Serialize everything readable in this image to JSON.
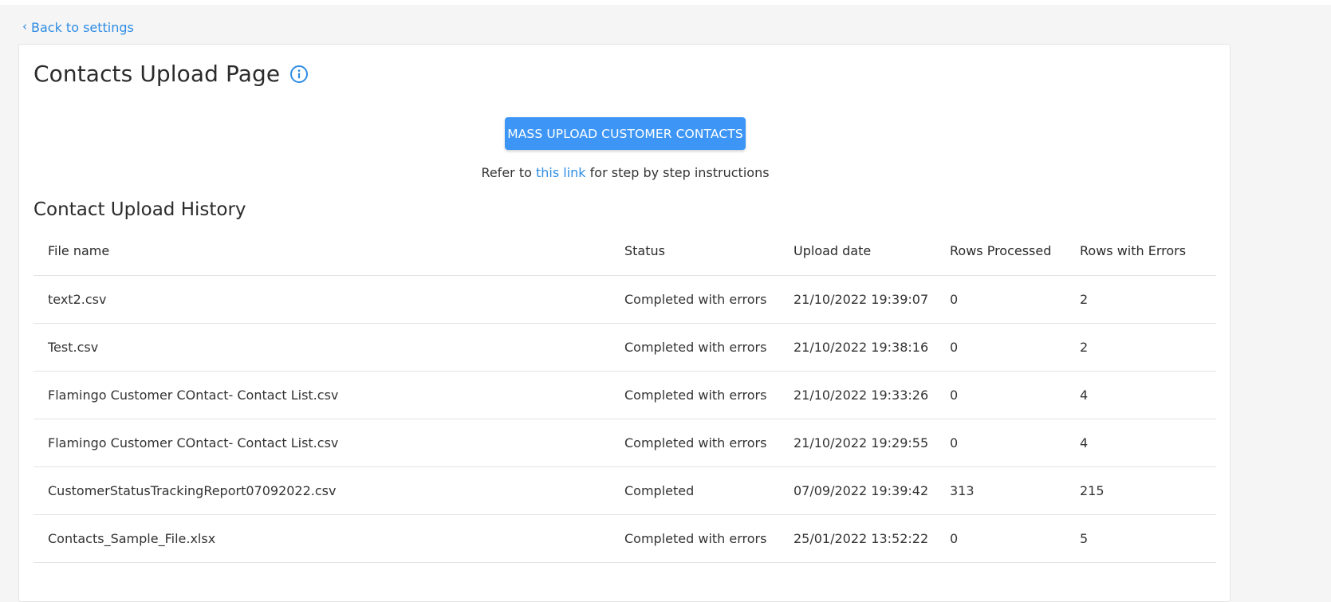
{
  "nav": {
    "back_label": "Back to settings"
  },
  "header": {
    "title": "Contacts Upload Page",
    "info_icon": "info-circle-icon"
  },
  "actions": {
    "upload_label": "MASS UPLOAD CUSTOMER CONTACTS"
  },
  "instructions": {
    "prefix": "Refer to",
    "link_text": "this link",
    "suffix": "for step by step instructions"
  },
  "history": {
    "title": "Contact Upload History",
    "columns": [
      "File name",
      "Status",
      "Upload date",
      "Rows Processed",
      "Rows with Errors"
    ],
    "rows": [
      {
        "file": "text2.csv",
        "status": "Completed with errors",
        "date": "21/10/2022 19:39:07",
        "processed": "0",
        "errors": "2"
      },
      {
        "file": "Test.csv",
        "status": "Completed with errors",
        "date": "21/10/2022 19:38:16",
        "processed": "0",
        "errors": "2"
      },
      {
        "file": "Flamingo Customer COntact- Contact List.csv",
        "status": "Completed with errors",
        "date": "21/10/2022 19:33:26",
        "processed": "0",
        "errors": "4"
      },
      {
        "file": "Flamingo Customer COntact- Contact List.csv",
        "status": "Completed with errors",
        "date": "21/10/2022 19:29:55",
        "processed": "0",
        "errors": "4"
      },
      {
        "file": "CustomerStatusTrackingReport07092022.csv",
        "status": "Completed",
        "date": "07/09/2022 19:39:42",
        "processed": "313",
        "errors": "215"
      },
      {
        "file": "Contacts_Sample_File.xlsx",
        "status": "Completed with errors",
        "date": "25/01/2022 13:52:22",
        "processed": "0",
        "errors": "5"
      }
    ]
  },
  "colors": {
    "accent": "#3d96f5",
    "link": "#2f8de4",
    "background": "#f5f5f5"
  }
}
